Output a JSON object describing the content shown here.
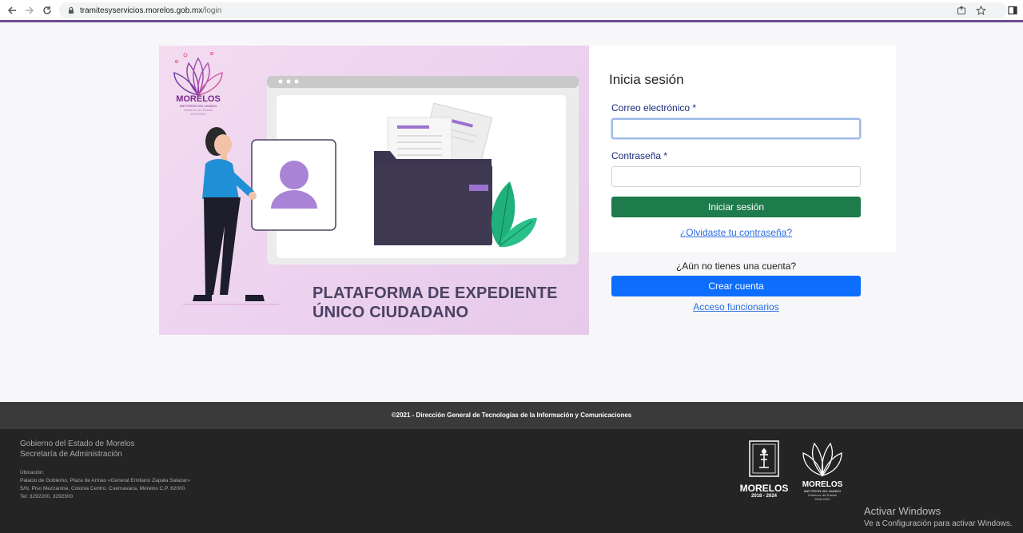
{
  "browser": {
    "url_host": "tramitesyservicios.morelos.gob.mx",
    "url_path": "/login"
  },
  "hero": {
    "logo_name": "MORELOS",
    "logo_tagline": "ANFITRIÓN DEL MUNDO",
    "logo_gov": "Gobierno del Estado",
    "logo_years": "2018-2024",
    "title_line1": "PLATAFORMA DE EXPEDIENTE",
    "title_line2": "ÚNICO CIUDADANO"
  },
  "login": {
    "title": "Inicia sesión",
    "email_label": "Correo electrónico",
    "password_label": "Contraseña",
    "required_mark": "*",
    "email_value": "",
    "password_value": "",
    "submit_label": "Iniciar sesión",
    "forgot_label": "¿Olvidaste tu contraseña?"
  },
  "signup": {
    "question": "¿Aún no tienes una cuenta?",
    "create_label": "Crear cuenta",
    "staff_label": "Acceso funcionarios"
  },
  "footer": {
    "copyright": "©2021 - Dirección General de Tecnologías de la Información y Comunicaciones",
    "gov_line1": "Gobierno del Estado de Morelos",
    "gov_line2": "Secretaría de Administración",
    "addr_title": "Ubicación:",
    "addr_line1": "Palacio de Gobierno, Plaza de Armas «General Emiliano Zapata Salazar»",
    "addr_line2": "S/N, Piso Mezzanine, Colonia Centro, Cuernavaca, Morelos C.P. 62000.",
    "addr_line3": "Tel: 3292200, 3292300",
    "seal_name": "MORELOS",
    "seal_years": "2018 - 2024",
    "logo_name": "MORELOS",
    "logo_tagline": "ANFITRIÓN DEL MUNDO",
    "logo_gov": "Gobierno del Estado",
    "logo_years": "2018-2024"
  },
  "windows": {
    "activate_title": "Activar Windows",
    "activate_sub": "Ve a Configuración para activar Windows."
  },
  "colors": {
    "accent": "#6a4c93",
    "login_button": "#1e7b4b",
    "create_button": "#0d6efd",
    "link": "#2a6ee0"
  }
}
